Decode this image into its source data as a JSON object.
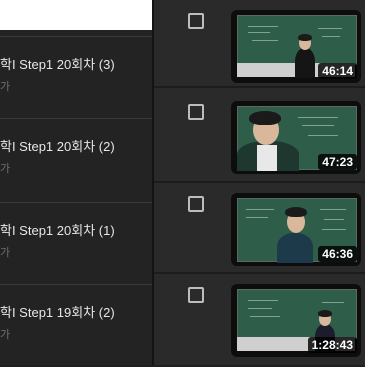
{
  "left_list": [
    {
      "title": "학I Step1 20회차 (3)",
      "subtitle": "가"
    },
    {
      "title": "학I Step1 20회차 (2)",
      "subtitle": "가"
    },
    {
      "title": "학I Step1 20회차 (1)",
      "subtitle": "가"
    },
    {
      "title": "학I Step1 19회차 (2)",
      "subtitle": "가"
    }
  ],
  "videos": [
    {
      "duration": "46:14",
      "checked": false
    },
    {
      "duration": "47:23",
      "checked": false
    },
    {
      "duration": "46:36",
      "checked": false
    },
    {
      "duration": "1:28:43",
      "checked": false
    }
  ],
  "colors": {
    "board": "#2e5e4a",
    "panel": "#2a2a2a",
    "text": "#e6e6e6"
  }
}
